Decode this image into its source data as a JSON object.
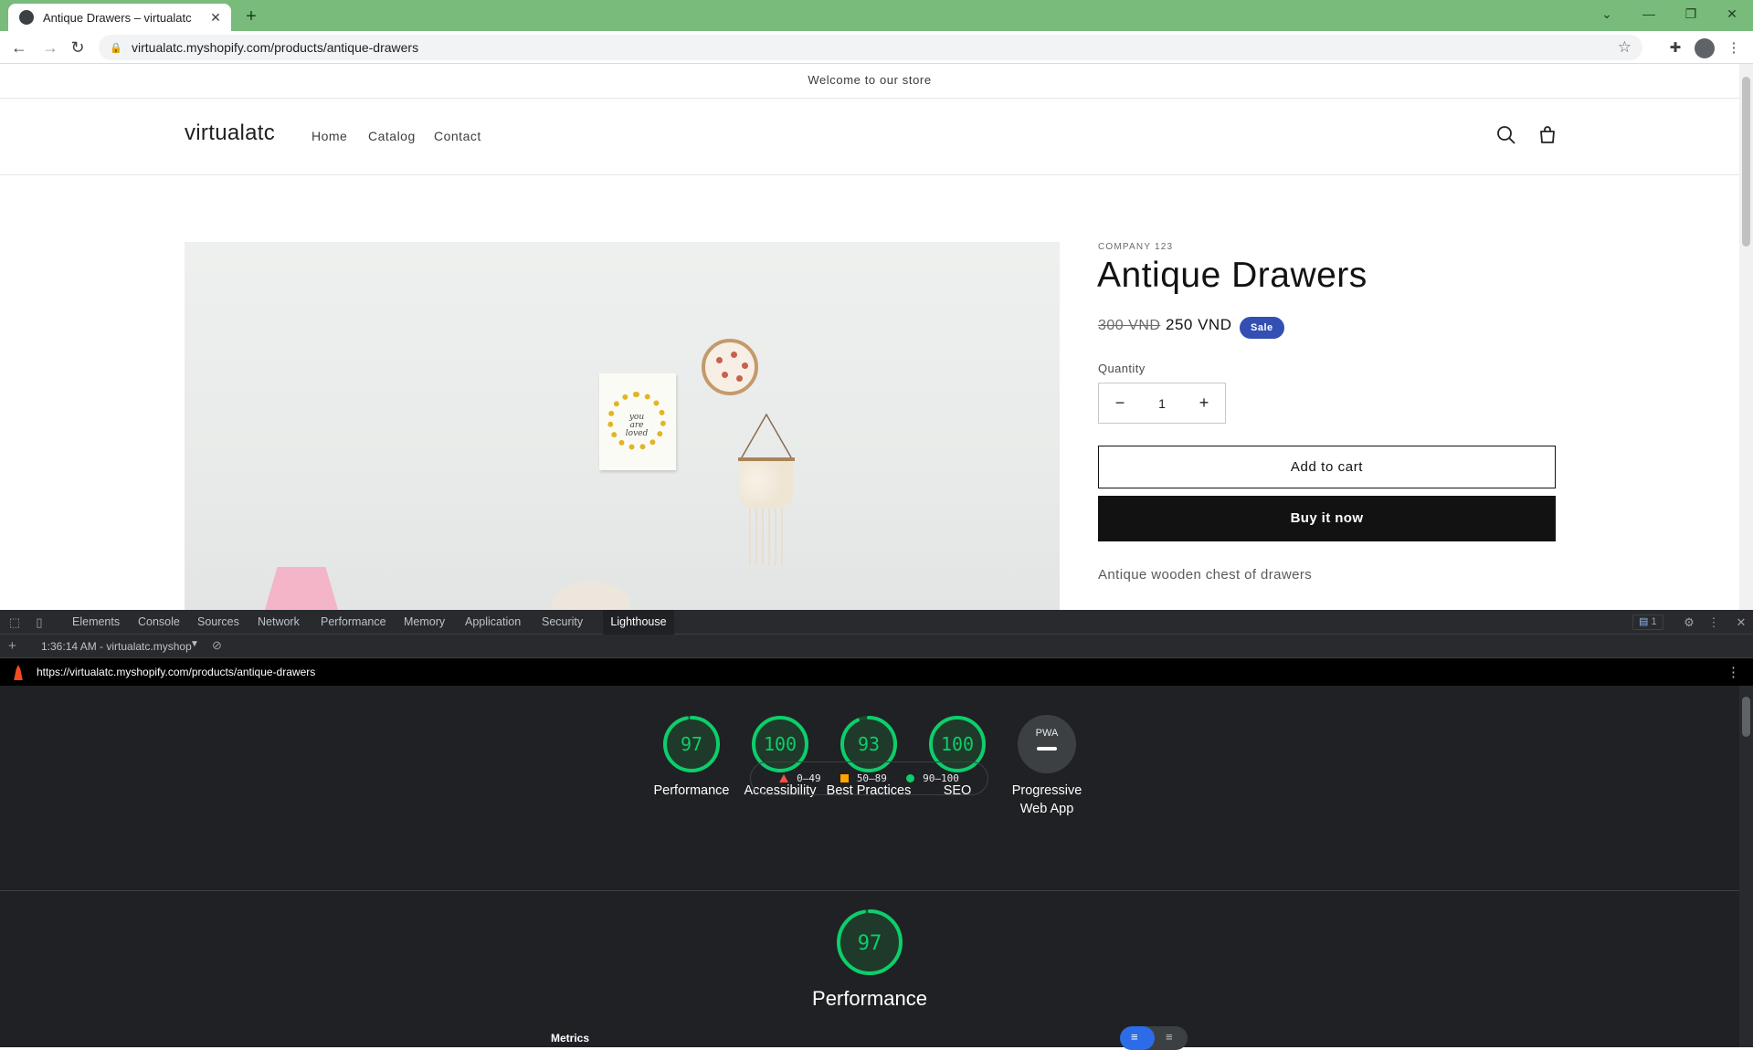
{
  "browser": {
    "tab_title": "Antique Drawers – virtualatc",
    "url": "virtualatc.myshopify.com/products/antique-drawers",
    "theme_color": "#78bb7b"
  },
  "store": {
    "announcement": "Welcome to our store",
    "logo": "virtualatc",
    "nav": [
      "Home",
      "Catalog",
      "Contact"
    ]
  },
  "product": {
    "vendor": "COMPANY 123",
    "title": "Antique Drawers",
    "price_old": "300 VND",
    "price_new": "250 VND",
    "badge": "Sale",
    "quantity_label": "Quantity",
    "quantity": "1",
    "add_to_cart": "Add to cart",
    "buy_now": "Buy it now",
    "description": "Antique wooden chest of drawers",
    "poster_text": "you are loved"
  },
  "devtools": {
    "tabs": [
      "Elements",
      "Console",
      "Sources",
      "Network",
      "Performance",
      "Memory",
      "Application",
      "Security",
      "Lighthouse"
    ],
    "active_tab": "Lighthouse",
    "issues_count": "1",
    "report_select": "1:36:14 AM - virtualatc.myshop",
    "report_url": "https://virtualatc.myshopify.com/products/antique-drawers"
  },
  "lighthouse": {
    "scores": [
      {
        "label": "Performance",
        "value": 97
      },
      {
        "label": "Accessibility",
        "value": 100
      },
      {
        "label": "Best Practices",
        "value": 93
      },
      {
        "label": "SEO",
        "value": 100
      },
      {
        "label": "Progressive Web App",
        "value": "PWA"
      }
    ],
    "legend": [
      "0–49",
      "50–89",
      "90–100"
    ],
    "legend_colors": {
      "fail": "#ff4e42",
      "average": "#ffa400",
      "pass": "#0cce6b"
    },
    "performance_score": "97",
    "performance_title": "Performance",
    "metrics_label": "Metrics"
  }
}
